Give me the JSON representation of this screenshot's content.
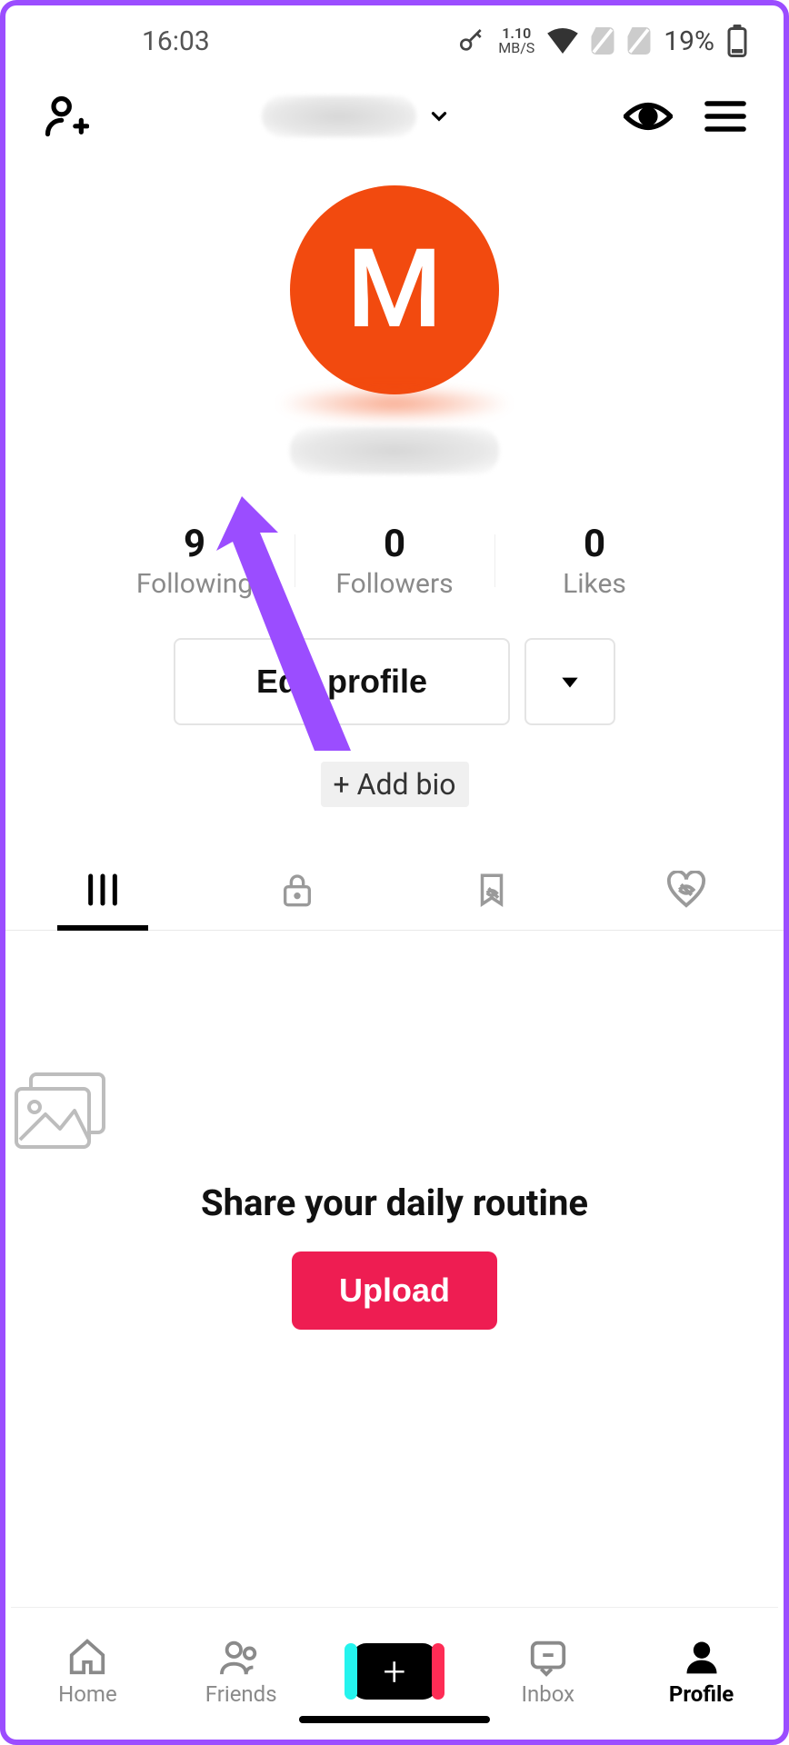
{
  "status": {
    "time": "16:03",
    "net_rate": "1.10",
    "net_unit": "MB/S",
    "battery": "19%"
  },
  "avatar": {
    "letter": "M"
  },
  "stats": {
    "following": {
      "count": "9",
      "label": "Following"
    },
    "followers": {
      "count": "0",
      "label": "Followers"
    },
    "likes": {
      "count": "0",
      "label": "Likes"
    }
  },
  "buttons": {
    "edit_profile": "Edit profile",
    "add_bio": "+ Add bio"
  },
  "empty": {
    "title": "Share your daily routine",
    "upload": "Upload"
  },
  "nav": {
    "home": "Home",
    "friends": "Friends",
    "inbox": "Inbox",
    "profile": "Profile"
  },
  "colors": {
    "accent": "#f24a0f",
    "primary_pink": "#ee1d52",
    "annotation": "#9b4dff"
  }
}
